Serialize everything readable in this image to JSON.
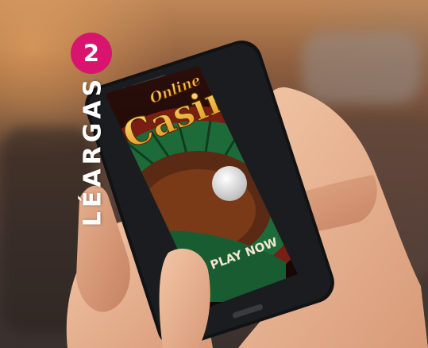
{
  "badge": {
    "number": "2",
    "color": "#d9146f"
  },
  "vertical_label": "LÉARGAS",
  "phone_screen": {
    "logo_small": "Online",
    "logo_large": "Casino",
    "button_text": "PLAY NOW"
  }
}
